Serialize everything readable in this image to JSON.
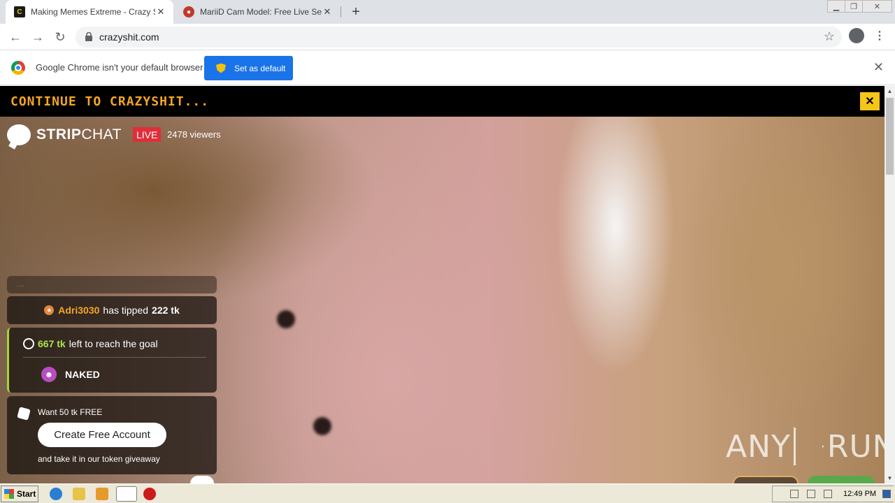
{
  "tabs": [
    {
      "title": "Making Memes Extreme - Crazy Shit",
      "favicon": "crazyshit-favicon",
      "active": true
    },
    {
      "title": "MariiD Cam Model: Free Live Sex Sho",
      "favicon": "stripchat-favicon",
      "active": false
    }
  ],
  "toolbar": {
    "url": "crazyshit.com"
  },
  "infobar": {
    "message": "Google Chrome isn't your default browser",
    "button": "Set as default"
  },
  "continue_bar": {
    "text": "CONTINUE TO CRAZYSHIT..."
  },
  "stream": {
    "brand": {
      "strip": "STRIP",
      "chat": "CHAT"
    },
    "live": "LIVE",
    "viewers": "2478 viewers",
    "tip": {
      "user": "Adri3030",
      "action": "has tipped",
      "amount": "222 tk"
    },
    "goal": {
      "tokens": "667 tk",
      "text": "left to reach the goal",
      "item": "NAKED"
    },
    "promo": {
      "want": "Want 50 tk FREE",
      "button": "Create Free Account",
      "sub": "and take it in our token giveaway"
    }
  },
  "watermark": {
    "left": "ANY",
    "right": "RUN"
  },
  "taskbar": {
    "start": "Start",
    "clock": "12:49 PM"
  },
  "colors": {
    "accent": "#1a73e8",
    "live": "#e02e3b",
    "goal": "#a4d43c",
    "continue": "#f5a623"
  }
}
